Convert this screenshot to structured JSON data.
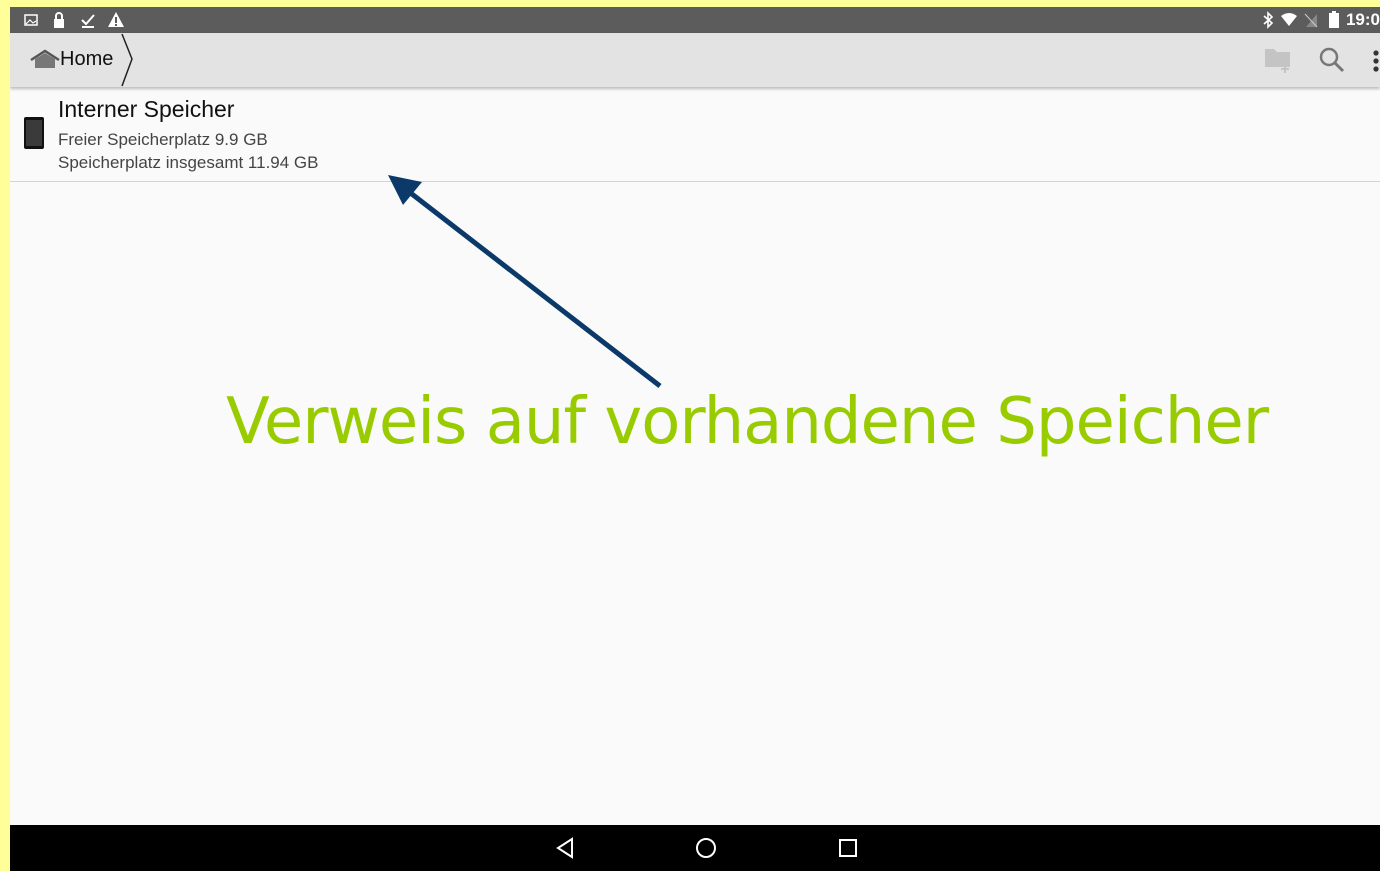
{
  "status_bar": {
    "left_icons": [
      "image-icon",
      "lock-icon",
      "download-done-icon",
      "warning-icon"
    ],
    "right_icons": [
      "bluetooth-icon",
      "wifi-icon",
      "no-sim-icon",
      "battery-icon"
    ],
    "time": "19:0"
  },
  "toolbar": {
    "breadcrumb_home": "Home",
    "actions": [
      "new-folder-icon",
      "search-icon",
      "overflow-menu-icon"
    ]
  },
  "storage": {
    "name": "Interner Speicher",
    "free": "Freier Speicherplatz 9.9 GB",
    "total": "Speicherplatz insgesamt 11.94 GB"
  },
  "annotation": {
    "text": "Verweis auf vorhandene Speicher",
    "text_color": "#99cc00",
    "arrow_color": "#0b3a6a"
  },
  "nav_bar": {
    "buttons": [
      "back-icon",
      "home-circle-icon",
      "recents-icon"
    ]
  },
  "colors": {
    "frame": "#ffff99",
    "status_bar": "#5c5c5c",
    "toolbar": "#e3e3e3",
    "background": "#fafafa",
    "nav_bar": "#000000"
  }
}
